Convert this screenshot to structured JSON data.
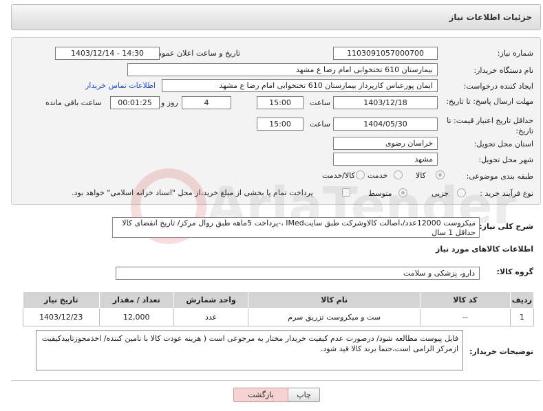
{
  "header": {
    "title": "جزئیات اطلاعات نیاز"
  },
  "form": {
    "need_number_label": "شماره نیاز:",
    "need_number": "1103091057000700",
    "announce_label": "تاریخ و ساعت اعلان عمومی:",
    "announce_value": "1403/12/14 - 14:30",
    "buyer_org_label": "نام دستگاه خریدار:",
    "buyer_org": "بیمارستان 610 تختخوابی امام رضا ع  مشهد",
    "creator_label": "ایجاد کننده درخواست:",
    "creator": "ایمان پورعباس کارپرداز بیمارستان 610 تختخوابی امام رضا ع  مشهد",
    "contact_link": "اطلاعات تماس خریدار",
    "deadline_label": "مهلت ارسال پاسخ: تا تاریخ:",
    "deadline_date": "1403/12/18",
    "time_label": "ساعت",
    "deadline_time": "15:00",
    "days_value": "4",
    "days_label": "روز و",
    "remaining_time": "00:01:25",
    "remaining_label": "ساعت باقی مانده",
    "validity_label": "حداقل تاریخ اعتبار قیمت: تا تاریخ:",
    "validity_date": "1404/05/30",
    "validity_time": "15:00",
    "province_label": "استان محل تحویل:",
    "province": "خراسان رضوی",
    "city_label": "شهر محل تحویل:",
    "city": "مشهد",
    "category_label": "طبقه بندی موضوعی:",
    "category_options": [
      "کالا",
      "خدمت",
      "کالا/خدمت"
    ],
    "process_label": "نوع فرآیند خرید :",
    "process_options": [
      "جزیی",
      "متوسط"
    ],
    "payment_note": "پرداخت تمام یا بخشی از مبلغ خرید،از محل \"اسناد خزانه اسلامی\" خواهد بود."
  },
  "description": {
    "label": "شرح کلی نیاز:",
    "text": "میکروست 12000عدد/،اصالت کالاوشرکت طبق سایتIMed ،-پرداخت 5ماهه طبق روال مرکز/ تاریخ انقضای کالا حداقل 1 سال"
  },
  "goods_section_title": "اطلاعات کالاهای مورد نیاز",
  "goods_group_label": "گروه کالا:",
  "goods_group": "دارو، پزشکی و سلامت",
  "table": {
    "headers": [
      "ردیف",
      "کد کالا",
      "نام کالا",
      "واحد شمارش",
      "تعداد / مقدار",
      "تاریخ نیاز"
    ],
    "rows": [
      [
        "1",
        "--",
        "ست و میکروست تزریق سرم",
        "عدد",
        "12,000",
        "1403/12/23"
      ]
    ]
  },
  "buyer_notes": {
    "label": "توضیحات خریدار:",
    "text": "فایل پیوست مطالعه شود/ درصورت عدم کیفیت خریدار مختار به مرجوعی است ( هزینه عودت کالا با تامین کننده/ اخذمجوزتاییدکیفیت ازمرکز الزامی است،حتما برند کالا قید شود."
  },
  "buttons": {
    "print": "چاپ",
    "back": "بازگشت"
  },
  "watermark_text": "AriaTender.net",
  "colors": {
    "link": "#1a4dcc",
    "back_button_bg": "#f6d3d3"
  }
}
